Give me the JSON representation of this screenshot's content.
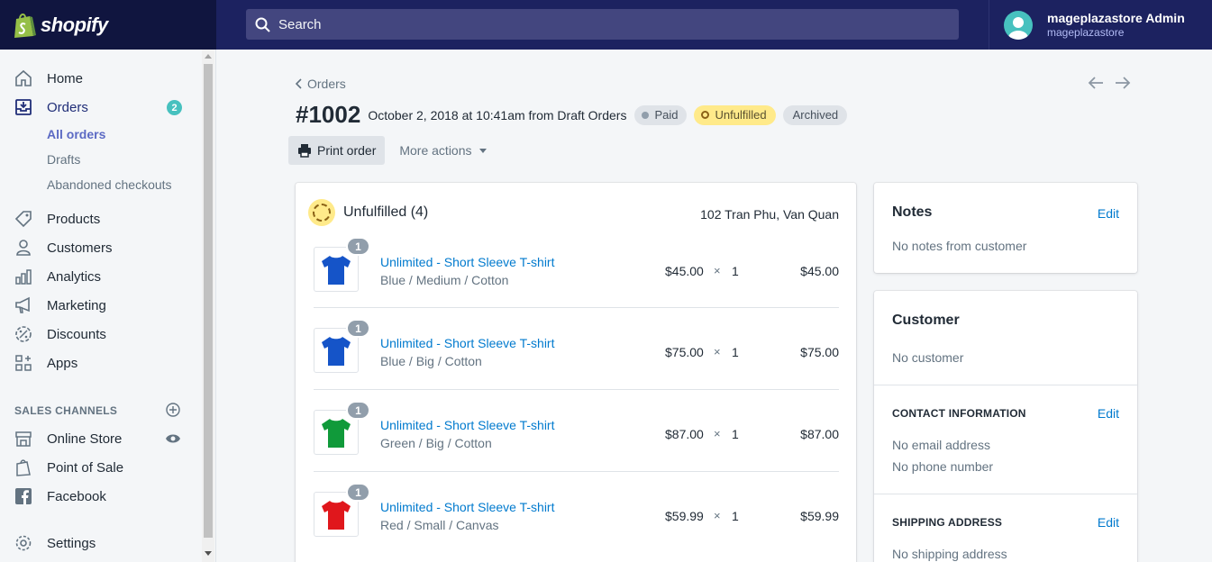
{
  "topbar": {
    "brand": "shopify",
    "search_placeholder": "Search",
    "user_name": "mageplazastore Admin",
    "user_store": "mageplazastore"
  },
  "sidebar": {
    "items": [
      {
        "label": "Home",
        "icon": "home-icon"
      },
      {
        "label": "Orders",
        "icon": "orders-icon",
        "badge": "2"
      },
      {
        "label": "Products",
        "icon": "tag-icon"
      },
      {
        "label": "Customers",
        "icon": "person-icon"
      },
      {
        "label": "Analytics",
        "icon": "bar-chart-icon"
      },
      {
        "label": "Marketing",
        "icon": "megaphone-icon"
      },
      {
        "label": "Discounts",
        "icon": "discount-icon"
      },
      {
        "label": "Apps",
        "icon": "apps-icon"
      }
    ],
    "orders_sub": [
      "All orders",
      "Drafts",
      "Abandoned checkouts"
    ],
    "sales_channels_title": "SALES CHANNELS",
    "channels": [
      {
        "label": "Online Store",
        "icon": "store-icon"
      },
      {
        "label": "Point of Sale",
        "icon": "bag-icon"
      },
      {
        "label": "Facebook",
        "icon": "facebook-icon"
      }
    ],
    "settings_label": "Settings"
  },
  "order": {
    "back_label": "Orders",
    "number": "#1002",
    "date": "October 2, 2018 at 10:41am from Draft Orders",
    "badges": {
      "paid": "Paid",
      "unfulfilled": "Unfulfilled",
      "archived": "Archived"
    },
    "print_label": "Print order",
    "more_actions_label": "More actions"
  },
  "fulfillment": {
    "title": "Unfulfilled (4)",
    "location": "102 Tran Phu, Van Quan",
    "items": [
      {
        "qty_badge": "1",
        "name": "Unlimited - Short Sleeve T-shirt",
        "variant": "Blue / Medium / Cotton",
        "price": "$45.00",
        "times": "×",
        "qty": "1",
        "total": "$45.00",
        "color": "#1554c8"
      },
      {
        "qty_badge": "1",
        "name": "Unlimited - Short Sleeve T-shirt",
        "variant": "Blue / Big / Cotton",
        "price": "$75.00",
        "times": "×",
        "qty": "1",
        "total": "$75.00",
        "color": "#1554c8"
      },
      {
        "qty_badge": "1",
        "name": "Unlimited - Short Sleeve T-shirt",
        "variant": "Green / Big / Cotton",
        "price": "$87.00",
        "times": "×",
        "qty": "1",
        "total": "$87.00",
        "color": "#109a3a"
      },
      {
        "qty_badge": "1",
        "name": "Unlimited - Short Sleeve T-shirt",
        "variant": "Red / Small / Canvas",
        "price": "$59.99",
        "times": "×",
        "qty": "1",
        "total": "$59.99",
        "color": "#e0171c"
      }
    ]
  },
  "notes": {
    "title": "Notes",
    "edit": "Edit",
    "text": "No notes from customer"
  },
  "customer": {
    "title": "Customer",
    "text": "No customer",
    "contact_title": "CONTACT INFORMATION",
    "contact_edit": "Edit",
    "email": "No email address",
    "phone": "No phone number",
    "shipping_title": "SHIPPING ADDRESS",
    "shipping_edit": "Edit",
    "shipping": "No shipping address"
  }
}
